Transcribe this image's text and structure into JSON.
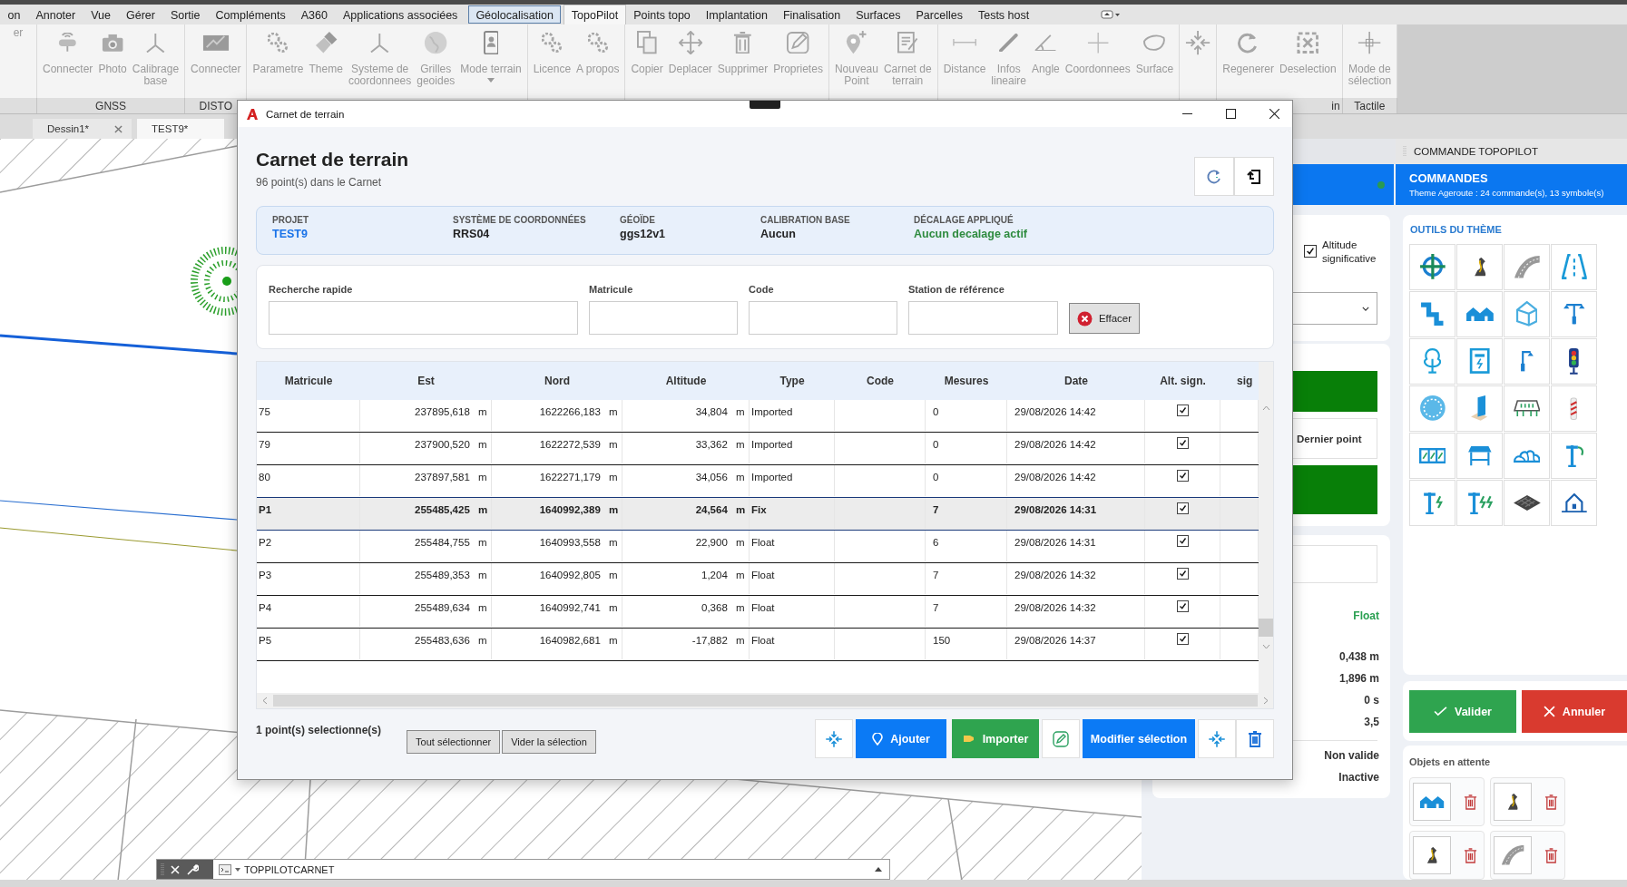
{
  "menu_tabs": [
    {
      "label": "on",
      "selected": false,
      "hovered": false
    },
    {
      "label": "Annoter",
      "selected": false,
      "hovered": false
    },
    {
      "label": "Vue",
      "selected": false,
      "hovered": false
    },
    {
      "label": "Gérer",
      "selected": false,
      "hovered": false
    },
    {
      "label": "Sortie",
      "selected": false,
      "hovered": false
    },
    {
      "label": "Compléments",
      "selected": false,
      "hovered": false
    },
    {
      "label": "A360",
      "selected": false,
      "hovered": false
    },
    {
      "label": "Applications associées",
      "selected": false,
      "hovered": false
    },
    {
      "label": "Géolocalisation",
      "selected": false,
      "hovered": true
    },
    {
      "label": "TopoPilot",
      "selected": true,
      "hovered": false
    },
    {
      "label": "Points topo",
      "selected": false,
      "hovered": false
    },
    {
      "label": "Implantation",
      "selected": false,
      "hovered": false
    },
    {
      "label": "Finalisation",
      "selected": false,
      "hovered": false
    },
    {
      "label": "Surfaces",
      "selected": false,
      "hovered": false
    },
    {
      "label": "Parcelles",
      "selected": false,
      "hovered": false
    },
    {
      "label": "Tests host",
      "selected": false,
      "hovered": false
    }
  ],
  "ribbon_panels": [
    {
      "buttons": [
        {
          "label": "er",
          "kind": "none",
          "dropdown": false
        }
      ]
    },
    {
      "label": "GNSS",
      "buttons": [
        {
          "label": "Connecter",
          "kind": "receiver",
          "dropdown": false
        },
        {
          "label": "Photo",
          "kind": "camera",
          "dropdown": false
        },
        {
          "label": "Calibrage\nbase",
          "kind": "axes",
          "dropdown": false
        }
      ]
    },
    {
      "label": "DISTO",
      "buttons": [
        {
          "label": "Connecter",
          "kind": "laser",
          "dropdown": false
        }
      ]
    },
    {
      "buttons": [
        {
          "label": "Parametre",
          "kind": "gears",
          "dropdown": false
        },
        {
          "label": "Theme",
          "kind": "brush",
          "dropdown": false
        },
        {
          "label": "Systeme de\ncoordonnees",
          "kind": "axes",
          "dropdown": false
        },
        {
          "label": "Grilles\ngeoides",
          "kind": "globe",
          "dropdown": false
        },
        {
          "label": "Mode terrain",
          "kind": "tablet",
          "dropdown": true
        }
      ]
    },
    {
      "buttons": [
        {
          "label": "Licence",
          "kind": "gears",
          "dropdown": false
        },
        {
          "label": "A propos",
          "kind": "gears",
          "dropdown": false
        }
      ]
    },
    {
      "buttons": [
        {
          "label": "Copier",
          "kind": "copy",
          "dropdown": false
        },
        {
          "label": "Deplacer",
          "kind": "move",
          "dropdown": false
        },
        {
          "label": "Supprimer",
          "kind": "trash",
          "dropdown": false
        },
        {
          "label": "Proprietes",
          "kind": "pencil",
          "dropdown": false
        }
      ]
    },
    {
      "buttons": [
        {
          "label": "Nouveau\nPoint",
          "kind": "pin",
          "dropdown": false
        },
        {
          "label": "Carnet de\nterrain",
          "kind": "notebook",
          "dropdown": false
        }
      ]
    },
    {
      "buttons": [
        {
          "label": "Distance",
          "kind": "ruler",
          "dropdown": false
        },
        {
          "label": "Infos\nlineaire",
          "kind": "line",
          "dropdown": false
        },
        {
          "label": "Angle",
          "kind": "angle",
          "dropdown": false
        },
        {
          "label": "Coordonnees",
          "kind": "coords",
          "dropdown": false
        },
        {
          "label": "Surface",
          "kind": "area",
          "dropdown": false
        }
      ]
    },
    {
      "buttons": [
        {
          "kind": "collapse",
          "dropdown": false
        }
      ]
    },
    {
      "label": "in",
      "buttons": [
        {
          "label": "Regenerer",
          "kind": "refresh",
          "dropdown": false
        },
        {
          "label": "Deselection",
          "kind": "deselect",
          "dropdown": false
        }
      ]
    },
    {
      "label": "Tactile",
      "buttons": [
        {
          "label": "Mode de\nsélection",
          "kind": "crosshair",
          "dropdown": false
        }
      ]
    }
  ],
  "doc_tabs": [
    {
      "label": "Dessin1*",
      "selected": false
    },
    {
      "label": "TEST9*",
      "selected": true
    }
  ],
  "dialog": {
    "title": "Carnet de terrain",
    "heading": "Carnet de terrain",
    "subtitle": "96 point(s) dans le Carnet",
    "info": [
      {
        "label": "PROJET",
        "value": "TEST9",
        "color": "#1a73e8"
      },
      {
        "label": "SYSTÈME DE COORDONNÉES",
        "value": "RRS04",
        "color": "#222222"
      },
      {
        "label": "GÉOÏDE",
        "value": "ggs12v1",
        "color": "#222222"
      },
      {
        "label": "CALIBRATION BASE",
        "value": "Aucun",
        "color": "#222222"
      },
      {
        "label": "DÉCALAGE APPLIQUÉ",
        "value": "Aucun decalage actif",
        "color": "#2e8b3e"
      }
    ],
    "filters": [
      {
        "label": "Recherche rapide"
      },
      {
        "label": "Matricule"
      },
      {
        "label": "Code"
      },
      {
        "label": "Station de référence"
      }
    ],
    "clear_button": "Effacer",
    "columns": [
      "Matricule",
      "Est",
      "Nord",
      "Altitude",
      "Type",
      "Code",
      "Mesures",
      "Date",
      "Alt. sign.",
      "sig"
    ],
    "rows": [
      {
        "matricule": "75",
        "est": "237895,618",
        "est_unit": "m",
        "nord": "1622266,183",
        "nord_unit": "m",
        "altitude": "34,804",
        "alt_unit": "m",
        "type": "Imported",
        "mesures": "0",
        "date": "29/08/2026 14:42",
        "alt_sign": true,
        "selected": false
      },
      {
        "matricule": "79",
        "est": "237900,520",
        "est_unit": "m",
        "nord": "1622272,539",
        "nord_unit": "m",
        "altitude": "33,362",
        "alt_unit": "m",
        "type": "Imported",
        "mesures": "0",
        "date": "29/08/2026 14:42",
        "alt_sign": true,
        "selected": false
      },
      {
        "matricule": "80",
        "est": "237897,581",
        "est_unit": "m",
        "nord": "1622271,179",
        "nord_unit": "m",
        "altitude": "34,056",
        "alt_unit": "m",
        "type": "Imported",
        "mesures": "0",
        "date": "29/08/2026 14:42",
        "alt_sign": true,
        "selected": false
      },
      {
        "matricule": "P1",
        "est": "255485,425",
        "est_unit": "m",
        "nord": "1640992,389",
        "nord_unit": "m",
        "altitude": "24,564",
        "alt_unit": "m",
        "type": "Fix",
        "mesures": "7",
        "date": "29/08/2026 14:31",
        "alt_sign": true,
        "selected": true
      },
      {
        "matricule": "P2",
        "est": "255484,755",
        "est_unit": "m",
        "nord": "1640993,558",
        "nord_unit": "m",
        "altitude": "22,900",
        "alt_unit": "m",
        "type": "Float",
        "mesures": "6",
        "date": "29/08/2026 14:31",
        "alt_sign": true,
        "selected": false
      },
      {
        "matricule": "P3",
        "est": "255489,353",
        "est_unit": "m",
        "nord": "1640992,805",
        "nord_unit": "m",
        "altitude": "1,204",
        "alt_unit": "m",
        "type": "Float",
        "mesures": "7",
        "date": "29/08/2026 14:32",
        "alt_sign": true,
        "selected": false
      },
      {
        "matricule": "P4",
        "est": "255489,634",
        "est_unit": "m",
        "nord": "1640992,741",
        "nord_unit": "m",
        "altitude": "0,368",
        "alt_unit": "m",
        "type": "Float",
        "mesures": "7",
        "date": "29/08/2026 14:32",
        "alt_sign": true,
        "selected": false
      },
      {
        "matricule": "P5",
        "est": "255483,636",
        "est_unit": "m",
        "nord": "1640982,681",
        "nord_unit": "m",
        "altitude": "-17,882",
        "alt_unit": "m",
        "type": "Float",
        "mesures": "150",
        "date": "29/08/2026 14:37",
        "alt_sign": true,
        "selected": false
      }
    ],
    "selection_count": "1 point(s) selectionne(s)",
    "select_all": "Tout sélectionner",
    "clear_selection": "Vider la sélection",
    "add": "Ajouter",
    "import": "Importer",
    "modify": "Modifier sélection"
  },
  "side_panel": {
    "altitude_option": {
      "label": "Altitude\nsignificative",
      "checked": true
    },
    "last_point": "Dernier point",
    "solution": "Float",
    "values": [
      "0,438 m",
      "1,896 m",
      "0 s",
      "3,5"
    ],
    "statuses": [
      "Non valide",
      "Inactive"
    ]
  },
  "command_panel": {
    "title": "COMMANDE TOPOPILOT",
    "heading": "COMMANDES",
    "summary": "Theme Ageroute : 24 commande(s), 13 symbole(s)",
    "tools_title": "OUTILS DU THÈME",
    "tools": [
      {
        "kind": "target"
      },
      {
        "kind": "road-curve"
      },
      {
        "kind": "road"
      },
      {
        "kind": "lanes"
      },
      {
        "kind": "pipe"
      },
      {
        "kind": "houses"
      },
      {
        "kind": "house"
      },
      {
        "kind": "double-lamp"
      },
      {
        "kind": "tree"
      },
      {
        "kind": "power-box"
      },
      {
        "kind": "lamp"
      },
      {
        "kind": "traffic-light"
      },
      {
        "kind": "manhole"
      },
      {
        "kind": "door"
      },
      {
        "kind": "greenhouse"
      },
      {
        "kind": "post"
      },
      {
        "kind": "windows"
      },
      {
        "kind": "shelter"
      },
      {
        "kind": "rocks"
      },
      {
        "kind": "pole-hook"
      },
      {
        "kind": "pole-bolt"
      },
      {
        "kind": "pole-bolts"
      },
      {
        "kind": "grating"
      },
      {
        "kind": "home"
      }
    ],
    "validate": "Valider",
    "cancel": "Annuler",
    "pending_title": "Objets en attente",
    "pending": [
      {
        "kind": "houses"
      },
      {
        "kind": "road-curve"
      },
      {
        "kind": "road-curve"
      },
      {
        "kind": "road"
      }
    ]
  },
  "command_line": {
    "value": "TOPPILOTCARNET"
  }
}
